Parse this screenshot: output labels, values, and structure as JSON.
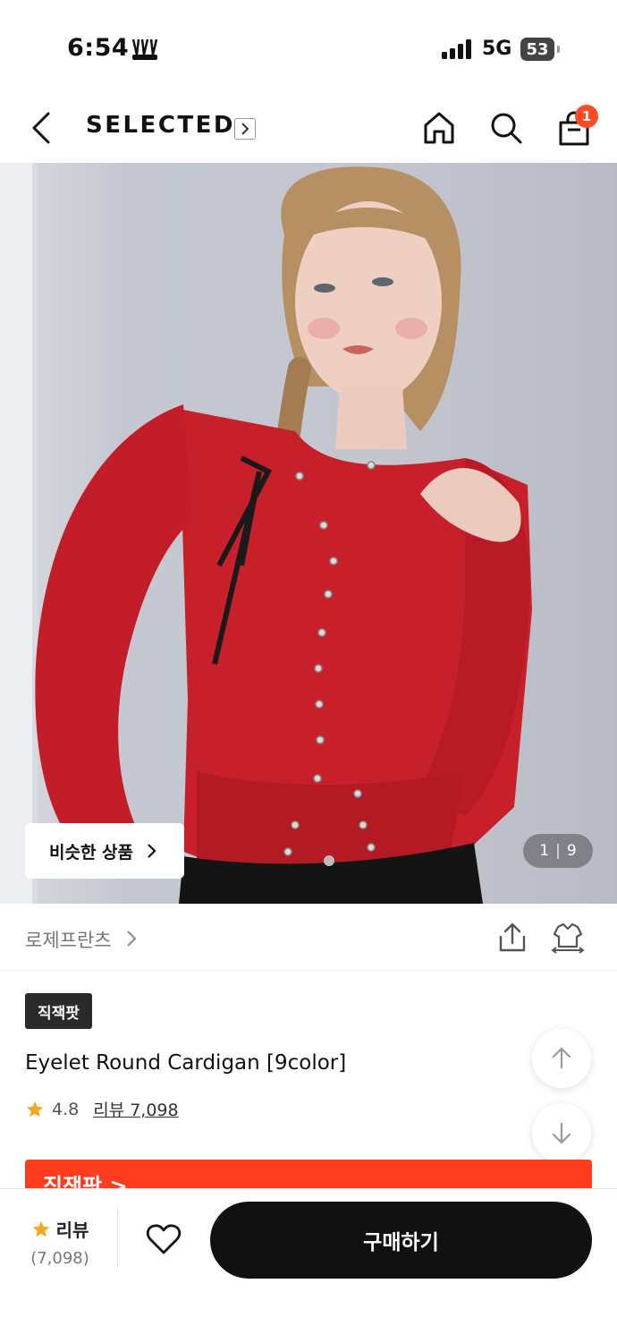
{
  "status_bar": {
    "time": "6:54",
    "network": "5G",
    "battery": "53"
  },
  "header": {
    "brand": "SELECTED",
    "cart_count": "1"
  },
  "gallery": {
    "similar_label": "비슷한 상품",
    "current": "1",
    "total": "9"
  },
  "product": {
    "seller": "로제프란츠",
    "badge": "직잭팟",
    "title": "Eyelet Round Cardigan [9color]",
    "rating": "4.8",
    "review_label": "리뷰 7,098",
    "promo_text": "직잭팟 >"
  },
  "bottom_bar": {
    "review_label": "리뷰",
    "review_count": "(7,098)",
    "buy_label": "구매하기"
  },
  "colors": {
    "accent": "#ff4b25",
    "star": "#f5a623",
    "buy_button": "#111111",
    "cardigan": "#c8202b"
  },
  "icons": [
    "back-arrow-icon",
    "home-icon",
    "search-icon",
    "shopping-bag-icon",
    "share-icon",
    "compare-icon",
    "star-icon",
    "heart-icon",
    "arrow-up-icon",
    "arrow-down-icon",
    "chevron-right-icon"
  ]
}
